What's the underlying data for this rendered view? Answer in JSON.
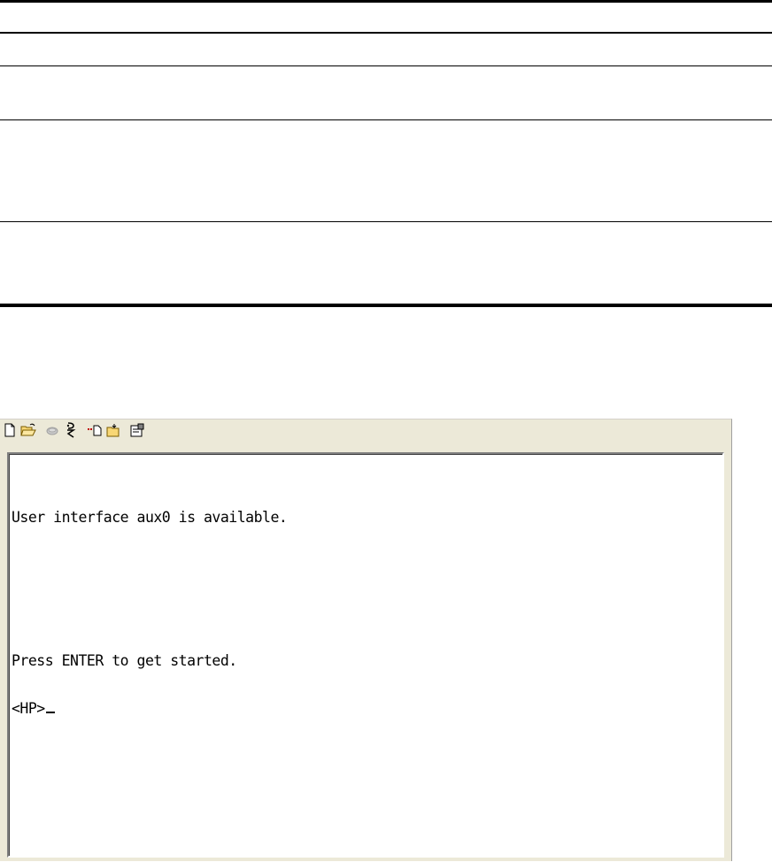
{
  "toolbar": {
    "buttons": [
      {
        "icon": "new-file-icon"
      },
      {
        "icon": "open-folder-icon"
      },
      {
        "icon": "connect-phone-icon"
      },
      {
        "icon": "disconnect-phone-icon"
      },
      {
        "icon": "send-file-icon"
      },
      {
        "icon": "receive-file-icon"
      },
      {
        "icon": "properties-icon"
      }
    ]
  },
  "terminal": {
    "line_1": "User interface aux0 is available.",
    "line_2": "Press ENTER to get started.",
    "prompt": "<HP>"
  }
}
